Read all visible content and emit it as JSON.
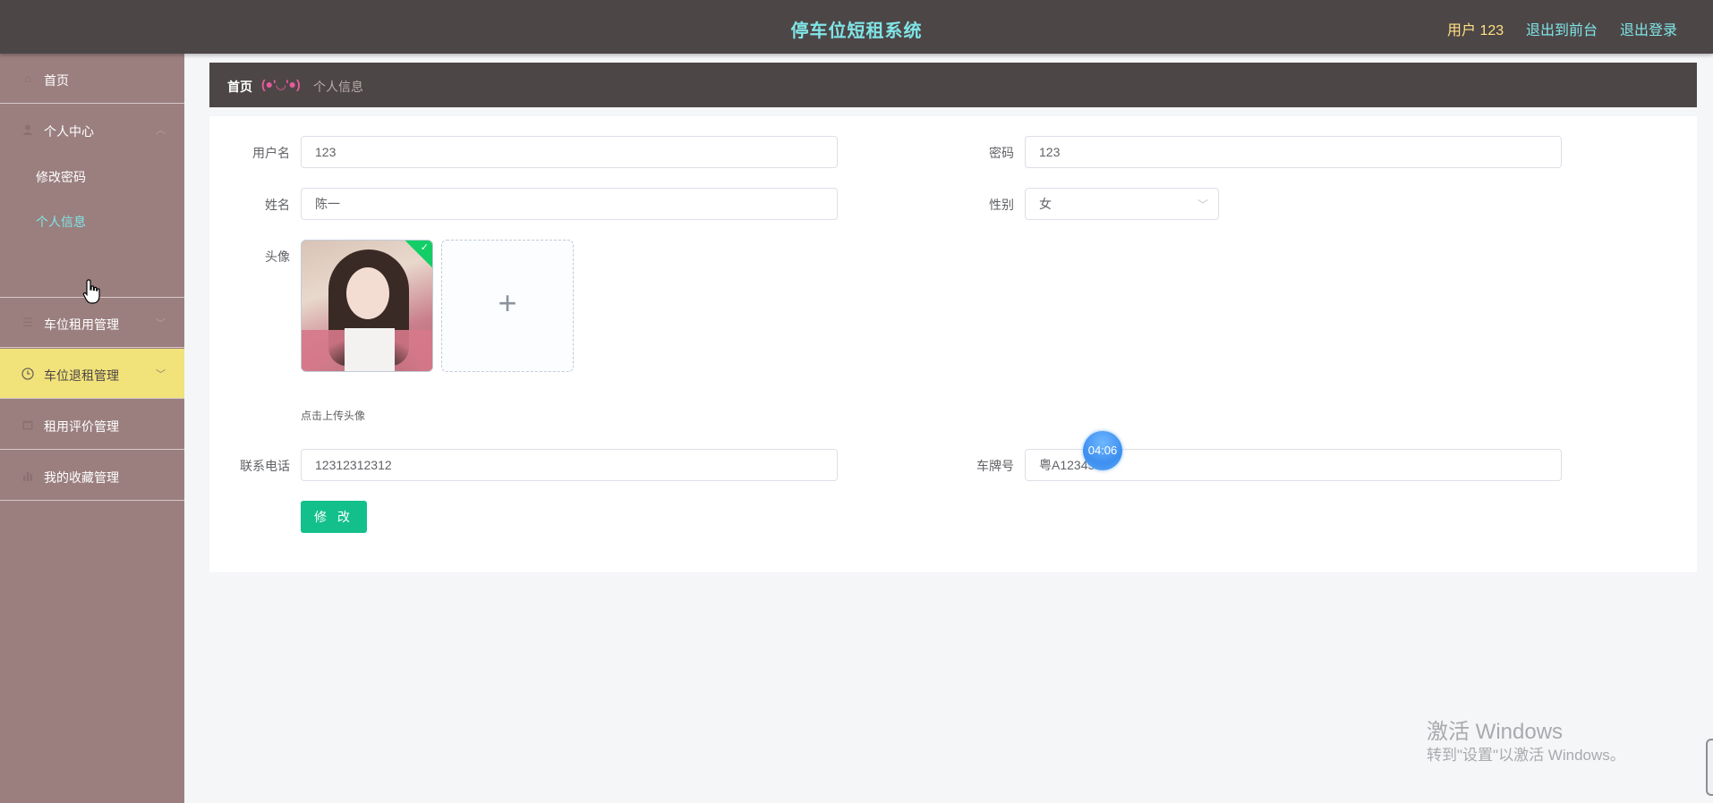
{
  "header": {
    "title": "停车位短租系统",
    "user": "用户 123",
    "links": [
      "退出到前台",
      "退出登录"
    ]
  },
  "sidebar": {
    "items": [
      {
        "label": "首页",
        "icon": "home-icon"
      },
      {
        "label": "个人中心",
        "icon": "user-icon",
        "expanded": true,
        "children": [
          "修改密码",
          "个人信息"
        ]
      },
      {
        "label": "车位租用管理",
        "icon": "list-icon"
      },
      {
        "label": "车位退租管理",
        "icon": "clock-icon",
        "hover": true
      },
      {
        "label": "租用评价管理",
        "icon": "calendar-icon"
      },
      {
        "label": "我的收藏管理",
        "icon": "chart-icon"
      }
    ],
    "current_child": "个人信息"
  },
  "breadcrumb": {
    "home": "首页",
    "separator": "(●'◡'●)",
    "current": "个人信息"
  },
  "form": {
    "username_label": "用户名",
    "username": "123",
    "password_label": "密码",
    "password": "123",
    "name_label": "姓名",
    "name": "陈一",
    "gender_label": "性别",
    "gender": "女",
    "avatar_label": "头像",
    "avatar_tip": "点击上传头像",
    "phone_label": "联系电话",
    "phone": "12312312312",
    "plate_label": "车牌号",
    "plate": "粤A12345",
    "submit": "修 改"
  },
  "overlay": {
    "timer": "04:06",
    "watermark_title": "激活 Windows",
    "watermark_sub": "转到\"设置\"以激活 Windows。"
  },
  "colors": {
    "topbar": "#4d4647",
    "sidebar": "#9b7f7f",
    "accent_cyan": "#7fe5e6",
    "hover_yellow": "#f1e27a",
    "button_green": "#13c08b"
  }
}
